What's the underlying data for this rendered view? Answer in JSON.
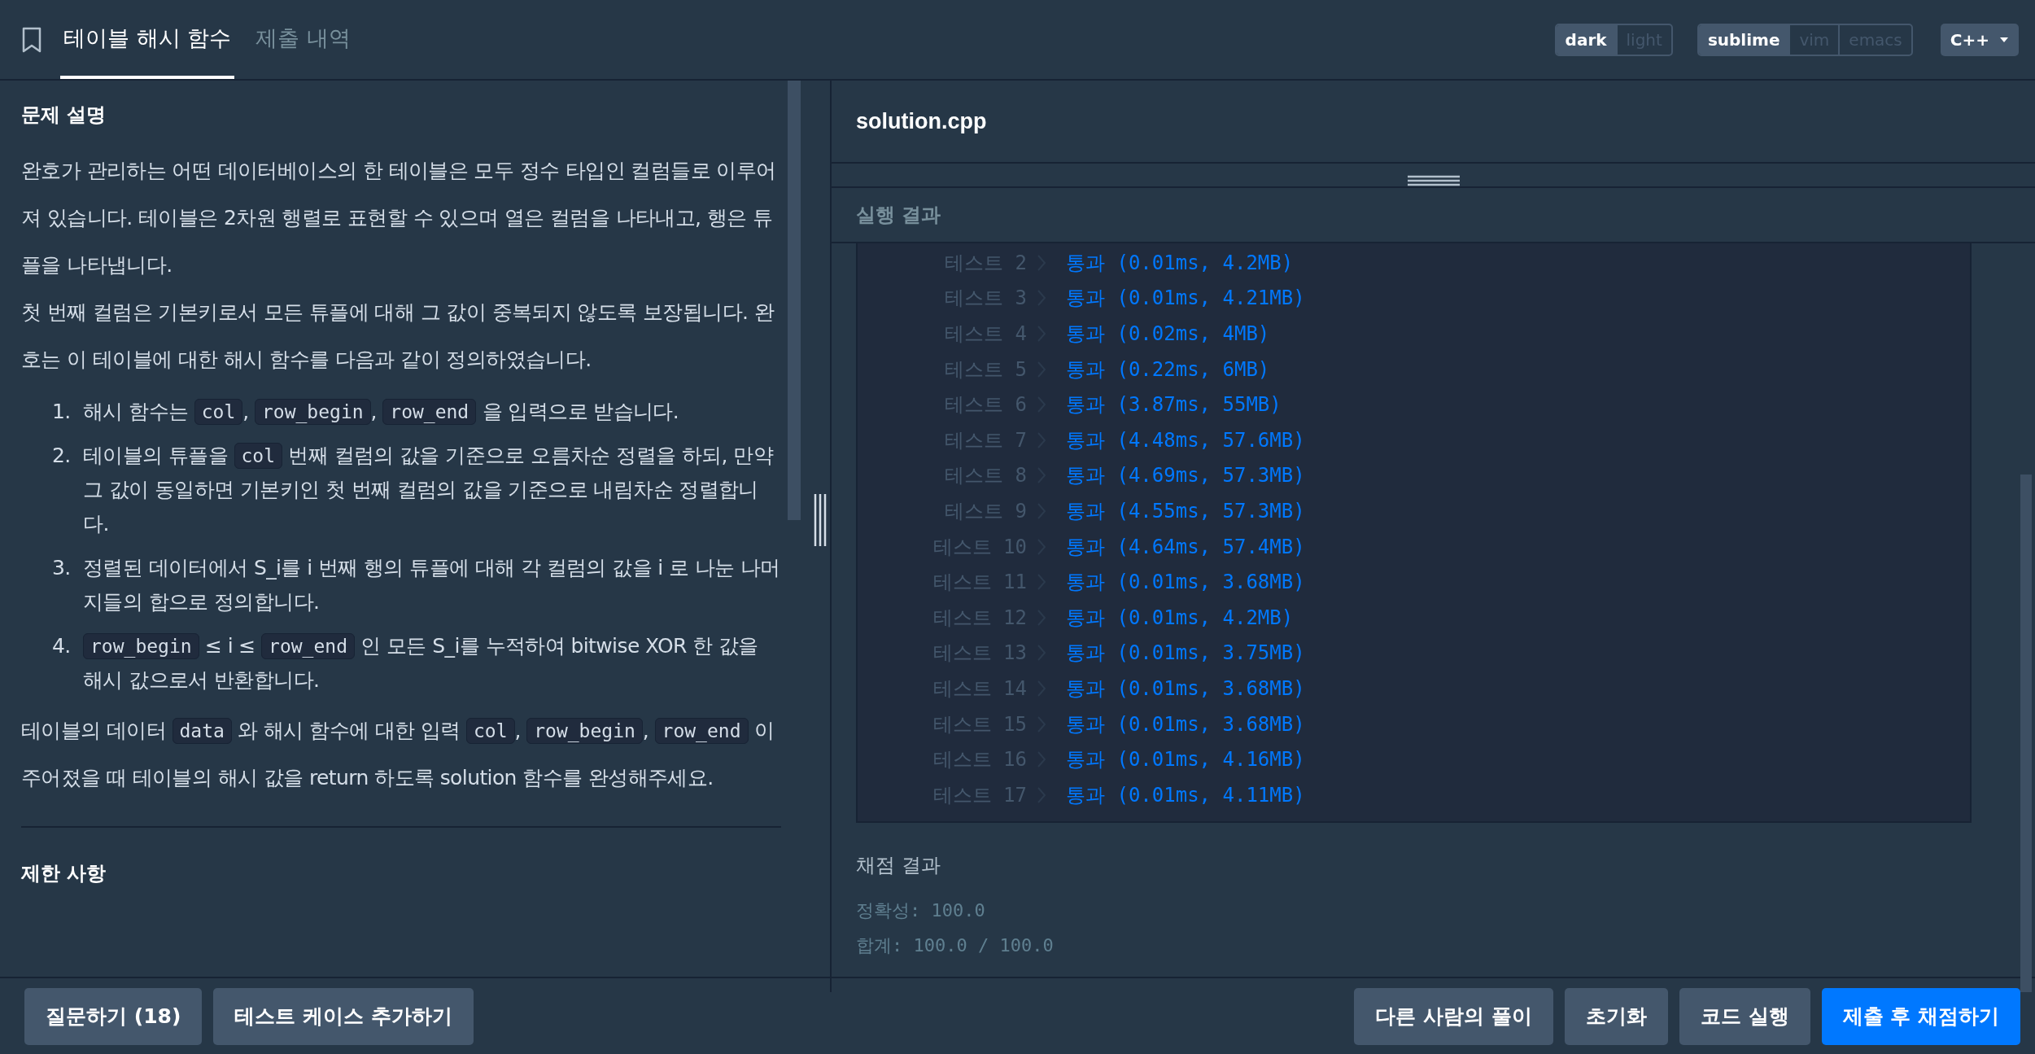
{
  "header": {
    "tabs": [
      {
        "label": "테이블 해시 함수",
        "selected": true
      },
      {
        "label": "제출 내역",
        "selected": false
      }
    ],
    "theme": [
      {
        "label": "dark",
        "selected": true
      },
      {
        "label": "light",
        "selected": false
      }
    ],
    "keymap": [
      {
        "label": "sublime",
        "selected": true
      },
      {
        "label": "vim",
        "selected": false
      },
      {
        "label": "emacs",
        "selected": false
      }
    ],
    "language": "C++"
  },
  "problem": {
    "heading": "문제 설명",
    "intro": [
      [
        {
          "text": "완호가 관리하는 어떤 데이터베이스의 한 테이블은 모두 정수 타입인 컬럼들로 이루어져 있습니다. 테이블은 2차원 행렬로 표현할 수 있으며 열은 컬럼을 나타내고, 행은 튜플을 나타냅니다."
        }
      ],
      [
        {
          "text": "첫 번째 컬럼은 기본키로서 모든 튜플에 대해 그 값이 중복되지 않도록 보장됩니다. 완호는 이 테이블에 대한 해시 함수를 다음과 같이 정의하였습니다."
        }
      ]
    ],
    "steps": [
      {
        "number": "1.",
        "parts": [
          {
            "text": "해시 함수는 "
          },
          {
            "code": "col"
          },
          {
            "text": ", "
          },
          {
            "code": "row_begin"
          },
          {
            "text": ", "
          },
          {
            "code": "row_end"
          },
          {
            "text": " 을 입력으로 받습니다."
          }
        ]
      },
      {
        "number": "2.",
        "parts": [
          {
            "text": "테이블의 튜플을 "
          },
          {
            "code": "col"
          },
          {
            "text": " 번째 컬럼의 값을 기준으로 오름차순 정렬을 하되, 만약 그 값이 동일하면 기본키인 첫 번째 컬럼의 값을 기준으로 내림차순 정렬합니다."
          }
        ]
      },
      {
        "number": "3.",
        "parts": [
          {
            "text": "정렬된 데이터에서 S_i를 i 번째 행의 튜플에 대해 각 컬럼의 값을 i 로 나눈 나머지들의 합으로 정의합니다."
          }
        ]
      },
      {
        "number": "4.",
        "parts": [
          {
            "code": "row_begin"
          },
          {
            "text": " ≤ i ≤ "
          },
          {
            "code": "row_end"
          },
          {
            "text": " 인 모든 S_i를 누적하여 bitwise XOR 한 값을 해시 값으로서 반환합니다."
          }
        ]
      }
    ],
    "closing": [
      {
        "text": "테이블의 데이터 "
      },
      {
        "code": "data"
      },
      {
        "text": " 와 해시 함수에 대한 입력 "
      },
      {
        "code": "col"
      },
      {
        "text": ", "
      },
      {
        "code": "row_begin"
      },
      {
        "text": ", "
      },
      {
        "code": "row_end"
      },
      {
        "text": " 이 주어졌을 때 테이블의 해시 값을 return 하도록 solution 함수를 완성해주세요."
      }
    ],
    "limits_heading": "제한 사항"
  },
  "editor": {
    "filename": "solution.cpp"
  },
  "results": {
    "heading": "실행 결과",
    "rows": [
      {
        "label": "테스트 2",
        "result": "통과 (0.01ms, 4.2MB)"
      },
      {
        "label": "테스트 3",
        "result": "통과 (0.01ms, 4.21MB)"
      },
      {
        "label": "테스트 4",
        "result": "통과 (0.02ms, 4MB)"
      },
      {
        "label": "테스트 5",
        "result": "통과 (0.22ms, 6MB)"
      },
      {
        "label": "테스트 6",
        "result": "통과 (3.87ms, 55MB)"
      },
      {
        "label": "테스트 7",
        "result": "통과 (4.48ms, 57.6MB)"
      },
      {
        "label": "테스트 8",
        "result": "통과 (4.69ms, 57.3MB)"
      },
      {
        "label": "테스트 9",
        "result": "통과 (4.55ms, 57.3MB)"
      },
      {
        "label": "테스트 10",
        "result": "통과 (4.64ms, 57.4MB)"
      },
      {
        "label": "테스트 11",
        "result": "통과 (0.01ms, 3.68MB)"
      },
      {
        "label": "테스트 12",
        "result": "통과 (0.01ms, 4.2MB)"
      },
      {
        "label": "테스트 13",
        "result": "통과 (0.01ms, 3.75MB)"
      },
      {
        "label": "테스트 14",
        "result": "통과 (0.01ms, 3.68MB)"
      },
      {
        "label": "테스트 15",
        "result": "통과 (0.01ms, 3.68MB)"
      },
      {
        "label": "테스트 16",
        "result": "통과 (0.01ms, 4.16MB)"
      },
      {
        "label": "테스트 17",
        "result": "통과 (0.01ms, 4.11MB)"
      }
    ],
    "grading_heading": "채점 결과",
    "grading_lines": [
      "정확성: 100.0",
      "합계: 100.0 / 100.0"
    ]
  },
  "footer": {
    "left_buttons": [
      {
        "label": "질문하기 (18)",
        "kind": "secondary"
      },
      {
        "label": "테스트 케이스 추가하기",
        "kind": "secondary"
      }
    ],
    "right_buttons": [
      {
        "label": "다른 사람의 풀이",
        "kind": "secondary"
      },
      {
        "label": "초기화",
        "kind": "secondary"
      },
      {
        "label": "코드 실행",
        "kind": "secondary"
      },
      {
        "label": "제출 후 채점하기",
        "kind": "primary"
      }
    ]
  }
}
